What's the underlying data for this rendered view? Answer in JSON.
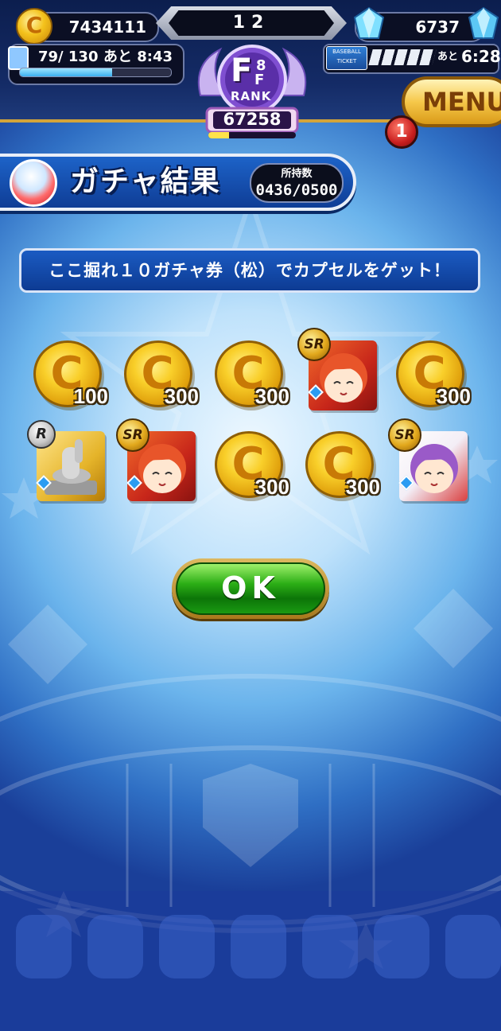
{
  "hud": {
    "coins": "7434111",
    "center_counter": "12",
    "gems": "6737",
    "stamina_text": "79/ 130",
    "stamina_timer": "あと  8:43",
    "stamina_fraction": 0.61,
    "ticket_label_1": "BASEBALL",
    "ticket_label_2": "TICKET",
    "ticket_timer": "6:28",
    "ticket_prefix": "あと",
    "rank_letter": "F",
    "rank_sub": "F",
    "rank_super": "8",
    "rank_word": "RANK",
    "rank_points": "67258",
    "menu_label": "MENU",
    "notification_count": "1"
  },
  "banner": {
    "title": "ガチャ結果",
    "owned_label": "所持数",
    "owned_value": "0436/0500"
  },
  "message": "ここ掘れ１０ガチャ券（松）でカプセルをゲット！",
  "items": [
    {
      "type": "coin",
      "amount": "100"
    },
    {
      "type": "coin",
      "amount": "300"
    },
    {
      "type": "coin",
      "amount": "300"
    },
    {
      "type": "card",
      "rarity": "SR",
      "theme": "red-hair"
    },
    {
      "type": "coin",
      "amount": "300"
    },
    {
      "type": "card",
      "rarity": "R",
      "theme": "statue"
    },
    {
      "type": "card",
      "rarity": "SR",
      "theme": "red-hair"
    },
    {
      "type": "coin",
      "amount": "300"
    },
    {
      "type": "coin",
      "amount": "300"
    },
    {
      "type": "card",
      "rarity": "SR",
      "theme": "purple-hair"
    }
  ],
  "coin_glyph": "C",
  "ok_label": "OK",
  "colors": {
    "gold": "#f4c21c",
    "panel_blue": "#1b5bc2",
    "ok_green": "#2cae16"
  }
}
